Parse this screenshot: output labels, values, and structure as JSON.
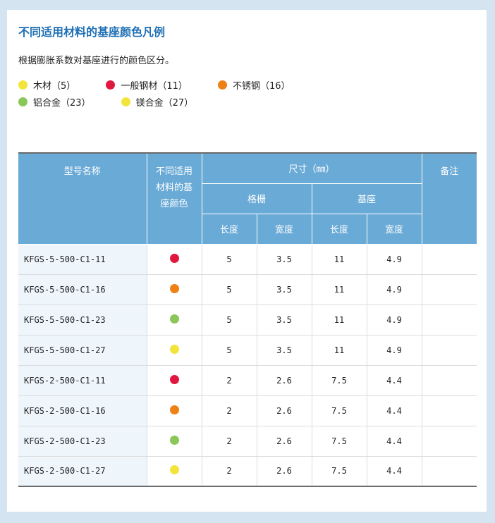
{
  "title": "不同适用材料的基座颜色凡例",
  "description": "根据膨胀系数对基座进行的颜色区分。",
  "legend": [
    {
      "label": "木材（5）",
      "color": "#f3e43b"
    },
    {
      "label": "一般钢材（11）",
      "color": "#e0173e"
    },
    {
      "label": "不锈钢（16）",
      "color": "#ee8014"
    },
    {
      "label": "铝合金（23）",
      "color": "#8bc659"
    },
    {
      "label": "镁合金（27）",
      "color": "#f3e43b"
    }
  ],
  "table": {
    "headers": {
      "model": "型号名称",
      "color": "不同适用材料的基座颜色",
      "size": "尺寸（㎜）",
      "grating": "格栅",
      "base": "基座",
      "length": "长度",
      "width": "宽度",
      "note": "备注"
    },
    "rows": [
      {
        "model": "KFGS-5-500-C1-11",
        "color": "#e0173e",
        "g_len": "5",
        "g_wid": "3.5",
        "b_len": "11",
        "b_wid": "4.9",
        "note": ""
      },
      {
        "model": "KFGS-5-500-C1-16",
        "color": "#ee8014",
        "g_len": "5",
        "g_wid": "3.5",
        "b_len": "11",
        "b_wid": "4.9",
        "note": ""
      },
      {
        "model": "KFGS-5-500-C1-23",
        "color": "#8bc659",
        "g_len": "5",
        "g_wid": "3.5",
        "b_len": "11",
        "b_wid": "4.9",
        "note": ""
      },
      {
        "model": "KFGS-5-500-C1-27",
        "color": "#f3e43b",
        "g_len": "5",
        "g_wid": "3.5",
        "b_len": "11",
        "b_wid": "4.9",
        "note": ""
      },
      {
        "model": "KFGS-2-500-C1-11",
        "color": "#e0173e",
        "g_len": "2",
        "g_wid": "2.6",
        "b_len": "7.5",
        "b_wid": "4.4",
        "note": ""
      },
      {
        "model": "KFGS-2-500-C1-16",
        "color": "#ee8014",
        "g_len": "2",
        "g_wid": "2.6",
        "b_len": "7.5",
        "b_wid": "4.4",
        "note": ""
      },
      {
        "model": "KFGS-2-500-C1-23",
        "color": "#8bc659",
        "g_len": "2",
        "g_wid": "2.6",
        "b_len": "7.5",
        "b_wid": "4.4",
        "note": ""
      },
      {
        "model": "KFGS-2-500-C1-27",
        "color": "#f3e43b",
        "g_len": "2",
        "g_wid": "2.6",
        "b_len": "7.5",
        "b_wid": "4.4",
        "note": ""
      }
    ]
  }
}
